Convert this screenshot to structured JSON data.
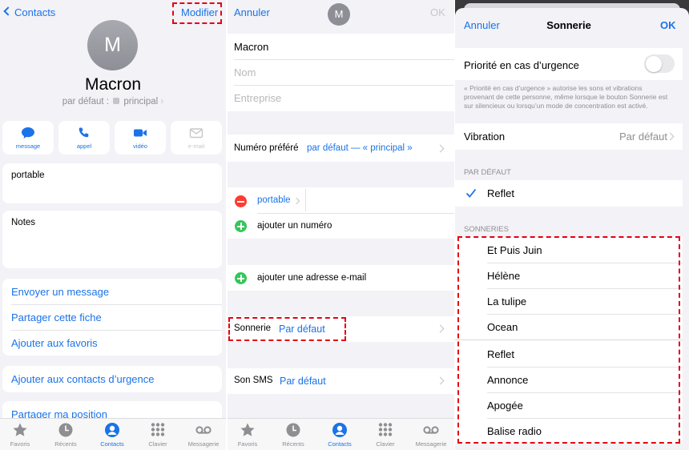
{
  "panel1": {
    "back_label": "Contacts",
    "edit_label": "Modifier",
    "avatar_initial": "M",
    "contact_name": "Macron",
    "subtitle_prefix": "par défaut :",
    "subtitle_value": "principal",
    "actions": [
      {
        "label": "message",
        "icon": "message-icon"
      },
      {
        "label": "appel",
        "icon": "phone-icon"
      },
      {
        "label": "vidéo",
        "icon": "video-icon"
      },
      {
        "label": "e-mail",
        "icon": "mail-icon"
      }
    ],
    "phone_label": "portable",
    "notes_label": "Notes",
    "links": [
      "Envoyer un message",
      "Partager cette fiche",
      "Ajouter aux favoris"
    ],
    "emergency_link": "Ajouter aux contacts d’urgence",
    "share_location": "Partager ma position"
  },
  "tabbar": [
    {
      "label": "Favoris",
      "icon": "star-icon"
    },
    {
      "label": "Récents",
      "icon": "clock-icon"
    },
    {
      "label": "Contacts",
      "icon": "person-icon"
    },
    {
      "label": "Clavier",
      "icon": "keypad-icon"
    },
    {
      "label": "Messagerie",
      "icon": "voicemail-icon"
    }
  ],
  "panel2": {
    "cancel_label": "Annuler",
    "ok_label": "OK",
    "avatar_initial": "M",
    "first_name": "Macron",
    "last_name_placeholder": "Nom",
    "company_placeholder": "Entreprise",
    "preferred_number_label": "Numéro préféré",
    "preferred_number_value": "par défaut — « principal »",
    "phone_type": "portable",
    "add_number": "ajouter un numéro",
    "add_email": "ajouter une adresse e-mail",
    "ringtone_label": "Sonnerie",
    "ringtone_value": "Par défaut",
    "sms_label": "Son SMS",
    "sms_value": "Par défaut"
  },
  "panel3": {
    "cancel_label": "Annuler",
    "title": "Sonnerie",
    "ok_label": "OK",
    "emergency_label": "Priorité en cas d’urgence",
    "emergency_note": "« Priorité en cas d’urgence » autorise les sons et vibrations provenant de cette personne, même lorsque le bouton Sonnerie est sur silencieux ou lorsqu’un mode de concentration est activé.",
    "vibration_label": "Vibration",
    "vibration_value": "Par défaut",
    "default_header": "PAR DÉFAUT",
    "default_item": "Reflet",
    "ringtones_header": "SONNERIES",
    "ringtones_group1": [
      "Et Puis Juin",
      "Hélène",
      "La tulipe",
      "Ocean"
    ],
    "ringtones_group2": [
      "Reflet",
      "Annonce",
      "Apogée",
      "Balise radio"
    ]
  },
  "colors": {
    "accent": "#1a73e8",
    "highlight": "#e60012",
    "toggle_off": "#e9e9eb"
  }
}
